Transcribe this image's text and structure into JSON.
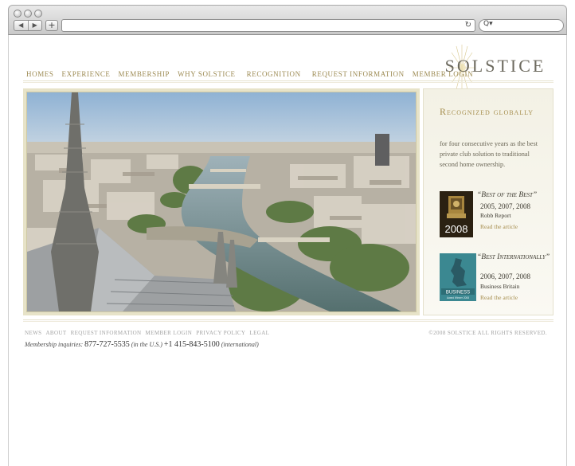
{
  "browser": {
    "nav_back": "◀",
    "nav_forward": "▶",
    "new_tab": "+",
    "reload": "↻",
    "search_icon": "Q▾"
  },
  "logo": {
    "text": "SOLSTICE"
  },
  "nav": {
    "items": [
      "HOMES",
      "EXPERIENCE",
      "MEMBERSHIP",
      "WHY SOLSTICE",
      "RECOGNITION",
      "REQUEST INFORMATION",
      "MEMBER LOGIN"
    ]
  },
  "sidebar": {
    "title": "Recognized globally",
    "description": "for four consecutive years as the best private club solution to traditional second home ownership.",
    "awards": [
      {
        "title": "“Best of the Best”",
        "years": "2005, 2007, 2008",
        "source": "Robb Report",
        "link": "Read the article",
        "badge_year": "2008"
      },
      {
        "title": "“Best Internationally”",
        "years": "2006, 2007, 2008",
        "source": "Business Britain",
        "link": "Read the article",
        "badge_label": "BUSINESS",
        "badge_sub": "Award Winner 2008"
      }
    ]
  },
  "footer": {
    "links": [
      "NEWS",
      "ABOUT",
      "REQUEST INFORMATION",
      "MEMBER LOGIN",
      "PRIVACY POLICY",
      "LEGAL"
    ],
    "copyright": "©2008 SOLSTICE ALL RIGHTS RESERVED.",
    "inquiry_label": "Membership inquiries:",
    "phone_us": "877-727-5535",
    "phone_us_note": "(in the U.S.)",
    "phone_intl": "+1 415-843-5100",
    "phone_intl_note": "(international)"
  },
  "colors": {
    "gold": "#a68e4e",
    "nav_gold": "#9c8a52",
    "grey_text": "#a4a4a4"
  }
}
